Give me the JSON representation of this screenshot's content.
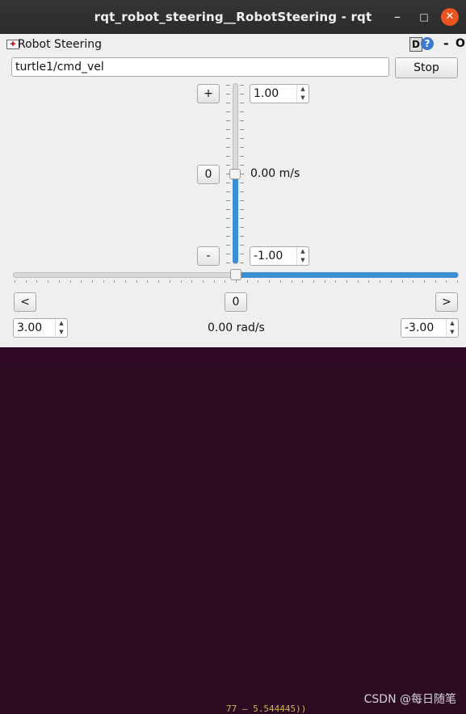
{
  "window": {
    "title": "rqt_robot_steering__RobotSteering - rqt",
    "minimize_glyph": "–",
    "maximize_glyph": "□",
    "close_glyph": "✕"
  },
  "dock": {
    "title": "Robot Steering",
    "d_button": "D",
    "help_button": "?",
    "dash_button": "-",
    "close_button": "O"
  },
  "topic": {
    "value": "turtle1/cmd_vel"
  },
  "stop_button": "Stop",
  "linear": {
    "increase_label": "+",
    "zero_label": "0",
    "decrease_label": "-",
    "max_value": "1.00",
    "min_value": "-1.00",
    "current": "0.00 m/s",
    "fraction": 0.5
  },
  "angular": {
    "left_label": "<",
    "zero_label": "0",
    "right_label": ">",
    "left_value": "3.00",
    "right_value": "-3.00",
    "current": "0.00 rad/s",
    "fraction": 0.5
  },
  "watermark": "CSDN @每日随笔",
  "background_text": "77 — 5.544445))",
  "colors": {
    "accent": "#3a8fd4",
    "close": "#e95420",
    "titlebar": "#2b2b2b"
  }
}
